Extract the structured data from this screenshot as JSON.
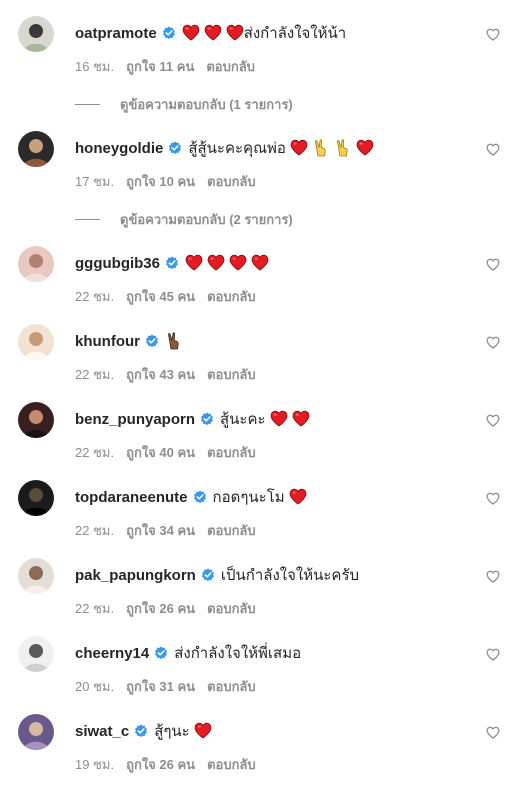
{
  "colors": {
    "heart_red": "#e31b23",
    "verified_blue": "#3897f0",
    "meta_gray": "#8e8e8e",
    "text": "#262626"
  },
  "comments": [
    {
      "username": "oatpramote",
      "verified": true,
      "text": "ส่งกำลังใจให้น้า",
      "emoji_before": [
        "red-heart",
        "red-heart",
        "red-heart"
      ],
      "emoji_after": [],
      "time": "16 ชม.",
      "likes": "ถูกใจ 11 คน",
      "reply": "ตอบกลับ",
      "view_replies": "ดูข้อความตอบกลับ (1 รายการ)"
    },
    {
      "username": "honeygoldie",
      "verified": true,
      "text": "สู้สู้นะคะคุณพ่อ",
      "emoji_before": [],
      "emoji_after": [
        "red-heart",
        "victory-hand",
        "victory-hand",
        "red-heart"
      ],
      "time": "17 ชม.",
      "likes": "ถูกใจ 10 คน",
      "reply": "ตอบกลับ",
      "view_replies": "ดูข้อความตอบกลับ (2 รายการ)"
    },
    {
      "username": "gggubgib36",
      "verified": true,
      "text": "",
      "emoji_before": [
        "red-heart",
        "red-heart",
        "red-heart",
        "red-heart"
      ],
      "emoji_after": [],
      "time": "22 ชม.",
      "likes": "ถูกใจ 45 คน",
      "reply": "ตอบกลับ"
    },
    {
      "username": "khunfour",
      "verified": true,
      "text": "",
      "emoji_before": [
        "victory-hand-dark"
      ],
      "emoji_after": [],
      "time": "22 ชม.",
      "likes": "ถูกใจ 43 คน",
      "reply": "ตอบกลับ"
    },
    {
      "username": "benz_punyaporn",
      "verified": true,
      "text": "สู้นะคะ",
      "emoji_before": [],
      "emoji_after": [
        "red-heart",
        "red-heart"
      ],
      "time": "22 ชม.",
      "likes": "ถูกใจ 40 คน",
      "reply": "ตอบกลับ"
    },
    {
      "username": "topdaraneenute",
      "verified": true,
      "text": "กอดๆนะโม",
      "emoji_before": [],
      "emoji_after": [
        "red-heart"
      ],
      "time": "22 ชม.",
      "likes": "ถูกใจ 34 คน",
      "reply": "ตอบกลับ"
    },
    {
      "username": "pak_papungkorn",
      "verified": true,
      "text": "เป็นกำลังใจให้นะครับ",
      "emoji_before": [],
      "emoji_after": [],
      "time": "22 ชม.",
      "likes": "ถูกใจ 26 คน",
      "reply": "ตอบกลับ"
    },
    {
      "username": "cheerny14",
      "verified": true,
      "text": "ส่งกำลังใจให้พี่เสมอ",
      "emoji_before": [],
      "emoji_after": [],
      "time": "20 ชม.",
      "likes": "ถูกใจ 31 คน",
      "reply": "ตอบกลับ"
    },
    {
      "username": "siwat_c",
      "verified": true,
      "text": "สู้ๆนะ",
      "emoji_before": [],
      "emoji_after": [
        "red-heart"
      ],
      "time": "19 ชม.",
      "likes": "ถูกใจ 26 คน",
      "reply": "ตอบกลับ"
    }
  ]
}
